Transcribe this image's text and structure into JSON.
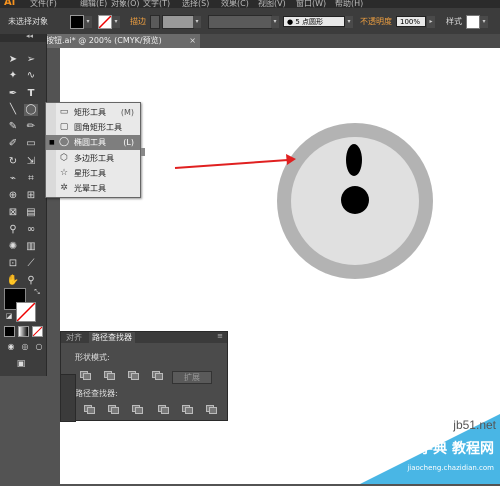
{
  "menubar": {
    "logo": "Ai",
    "items": [
      "文件(F)",
      "编辑(E)",
      "对象(O)",
      "文字(T)",
      "选择(S)",
      "效果(C)",
      "视图(V)",
      "窗口(W)",
      "帮助(H)"
    ]
  },
  "control_bar": {
    "selection_status": "未选择对象",
    "stroke_label": "描边",
    "brush_value": "5 点圆形",
    "opacity_label": "不透明度",
    "opacity_value": "100%",
    "style_label": "样式"
  },
  "document_tab": {
    "title": "按钮.ai* @ 200% (CMYK/预览)",
    "close": "×"
  },
  "toolbar": {
    "collapse": "◂◂",
    "fill_color": "#000000",
    "stroke_color": "#ffffff"
  },
  "flyout": {
    "items": [
      {
        "label": "矩形工具",
        "shortcut": "(M)",
        "icon": "rectangle-icon"
      },
      {
        "label": "圆角矩形工具",
        "shortcut": "",
        "icon": "rounded-rectangle-icon"
      },
      {
        "label": "椭圆工具",
        "shortcut": "(L)",
        "icon": "ellipse-icon"
      },
      {
        "label": "多边形工具",
        "shortcut": "",
        "icon": "polygon-icon"
      },
      {
        "label": "星形工具",
        "shortcut": "",
        "icon": "star-icon"
      },
      {
        "label": "光晕工具",
        "shortcut": "",
        "icon": "flare-icon"
      }
    ],
    "active_index": 2,
    "bullet": "■"
  },
  "pathfinder": {
    "tabs": [
      "对齐",
      "路径查找器"
    ],
    "active_tab": 1,
    "shape_modes_label": "形状模式:",
    "expand_label": "扩展",
    "pathfinders_label": "路径查找器:"
  },
  "artwork": {
    "outer_ring_color": "#b3b3b3",
    "inner_fill_color": "#e0e0e0",
    "dot_color": "#000000",
    "arrow_color": "#e02020"
  },
  "watermark": {
    "line1": "jb51.net",
    "line2": "查字典 教程网",
    "line3": "jiaocheng.chazidian.com"
  }
}
